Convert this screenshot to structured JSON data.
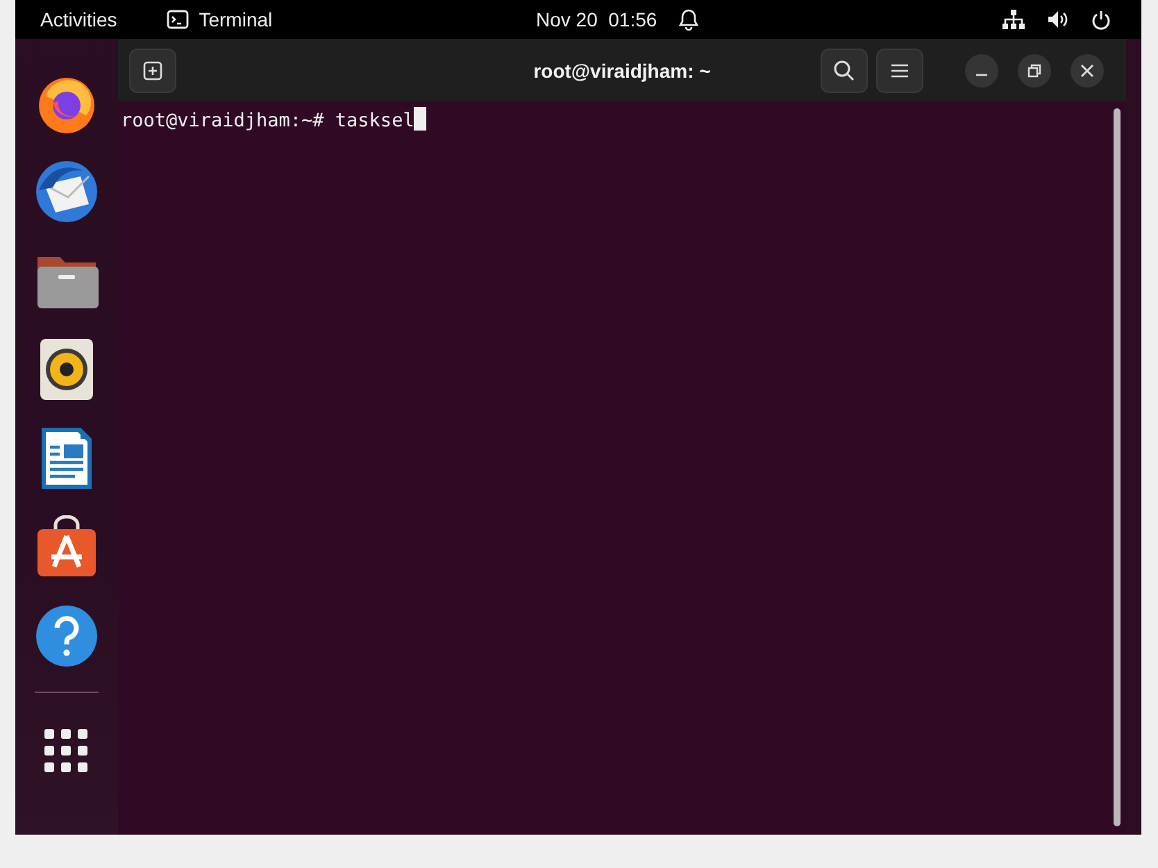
{
  "top_bar": {
    "activities": "Activities",
    "app_menu": "Terminal",
    "clock": "Nov 20  01:56"
  },
  "dock": [
    {
      "kind": "firefox"
    },
    {
      "kind": "mail"
    },
    {
      "kind": "files"
    },
    {
      "kind": "music"
    },
    {
      "kind": "writer"
    },
    {
      "kind": "store"
    },
    {
      "kind": "help"
    }
  ],
  "window": {
    "title": "root@viraidjham: ~"
  },
  "terminal": {
    "lines": [
      "root@viraidjham:~# tasksel"
    ]
  }
}
